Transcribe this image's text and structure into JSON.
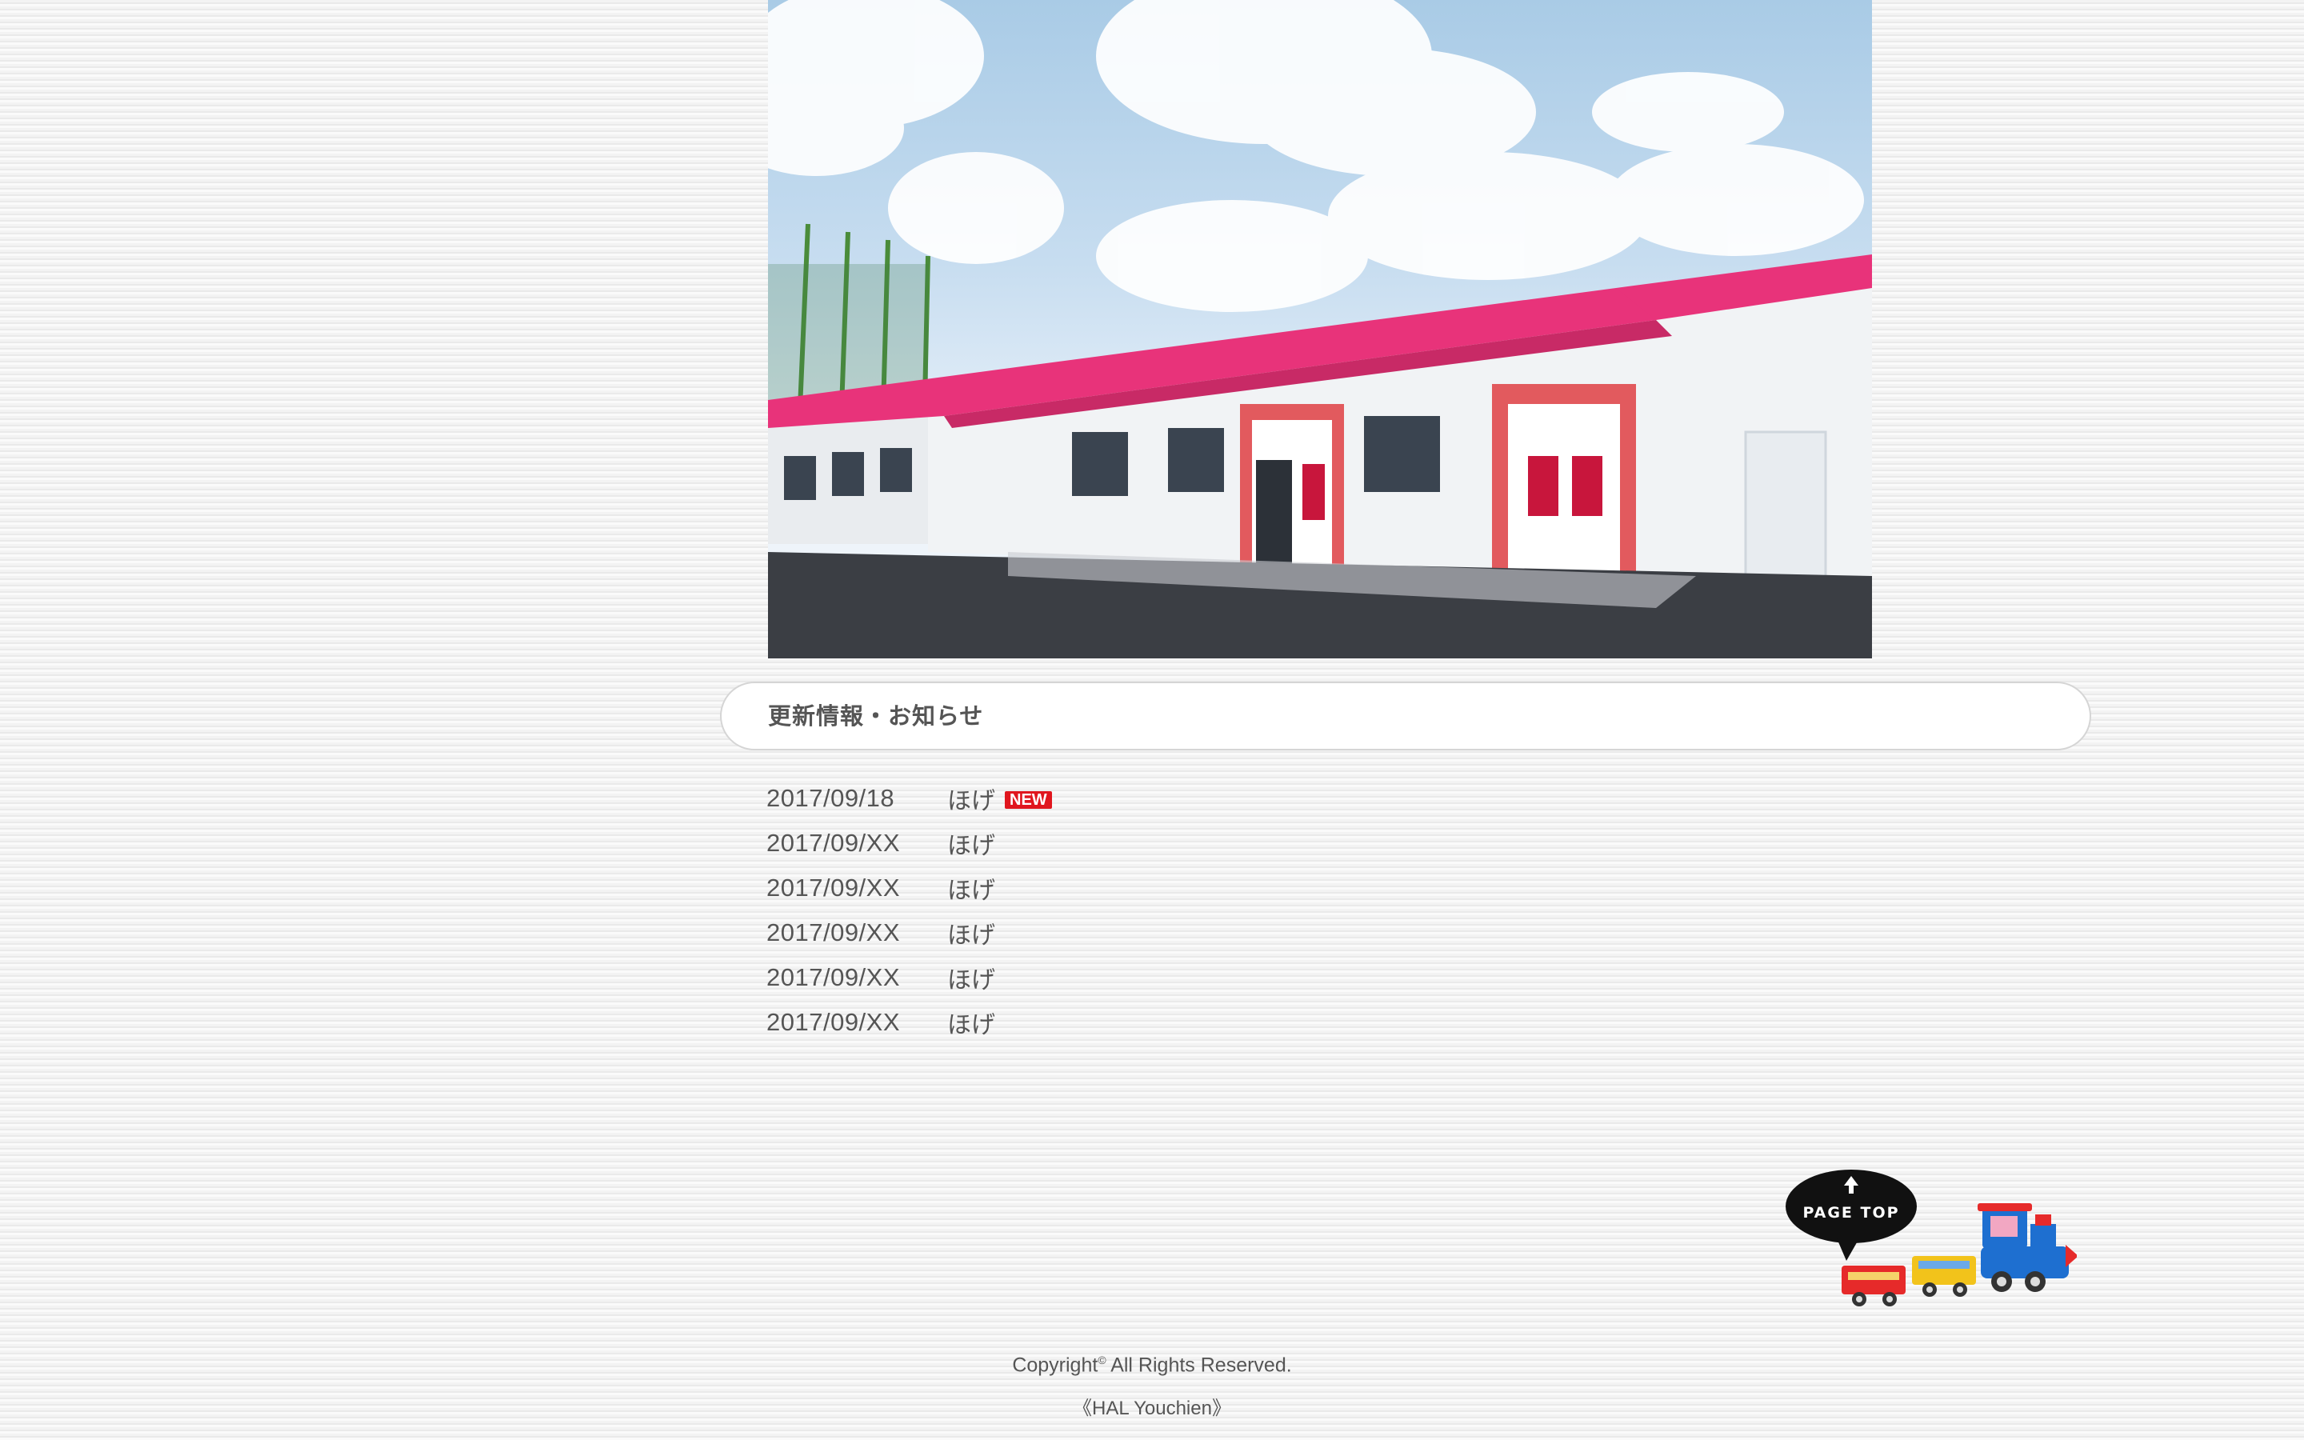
{
  "hero": {
    "image_label": "kindergarten building photo"
  },
  "news": {
    "title": "更新情報・お知らせ",
    "items": [
      {
        "date": "2017/09/18",
        "text": "ほげ",
        "badge": "NEW"
      },
      {
        "date": "2017/09/XX",
        "text": "ほげ"
      },
      {
        "date": "2017/09/XX",
        "text": "ほげ"
      },
      {
        "date": "2017/09/XX",
        "text": "ほげ"
      },
      {
        "date": "2017/09/XX",
        "text": "ほげ"
      },
      {
        "date": "2017/09/XX",
        "text": "ほげ"
      }
    ]
  },
  "page_top": {
    "label": "PAGE TOP",
    "icon": "arrow-up-icon"
  },
  "footer": {
    "copyright_prefix": "Copyright",
    "copyright_symbol": "©",
    "copyright_suffix": " All Rights Reserved.",
    "site_name": "《HAL Youchien》"
  },
  "colors": {
    "roof_pink": "#e8337a",
    "badge_red": "#e0161e",
    "train_red": "#e62a2a",
    "train_yellow": "#f2c31b",
    "train_blue": "#1e6fd0"
  }
}
